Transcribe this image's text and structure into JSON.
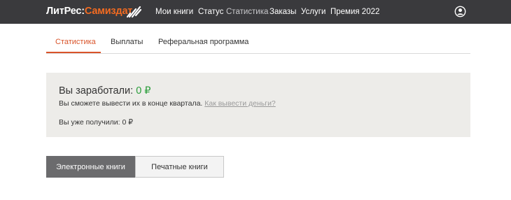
{
  "header": {
    "logo_main": "ЛитРес:",
    "logo_accent": "Самиздат",
    "nav": [
      "Мои книги",
      "Статус",
      "Статистика",
      "Заказы",
      "Услуги",
      "Премия 2022"
    ],
    "active_nav": "Статистика",
    "user_icon": "user-circle-icon"
  },
  "tabs": [
    "Статистика",
    "Выплаты",
    "Реферальная программа"
  ],
  "active_tab": "Статистика",
  "earnings": {
    "label": "Вы заработали:",
    "amount": "0 ₽",
    "hint": "Вы сможете вывести их в конце квартала.",
    "hint_link": "Как вывести деньги?",
    "received_label": "Вы уже получили:",
    "received_amount": "0 ₽"
  },
  "book_type_toggle": {
    "options": [
      "Электронные книги",
      "Печатные книги"
    ],
    "selected": "Электронные книги"
  },
  "colors": {
    "header_bg": "#3a3a3d",
    "brand_accent": "#f26b21",
    "active_tab": "#d9542a",
    "amount": "#2a9d3a",
    "panel_bg": "#edece9"
  }
}
